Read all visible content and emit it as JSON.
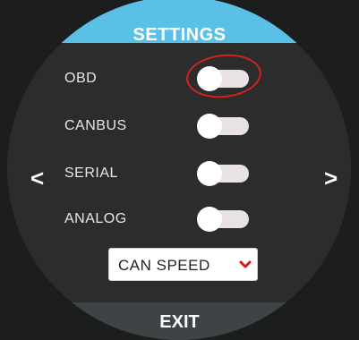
{
  "header": {
    "title": "SETTINGS"
  },
  "settings": [
    {
      "label": "OBD",
      "enabled": false
    },
    {
      "label": "CANBUS",
      "enabled": false
    },
    {
      "label": "SERIAL",
      "enabled": false
    },
    {
      "label": "ANALOG",
      "enabled": false
    }
  ],
  "nav": {
    "prev": "<",
    "next": ">"
  },
  "can_speed": {
    "label": "CAN SPEED"
  },
  "footer": {
    "exit_label": "EXIT"
  },
  "colors": {
    "accent": "#5bc0e5",
    "background": "#2c2c2c",
    "footer": "#3e4446",
    "highlight": "#d91f1f",
    "chevron": "#d11a1a"
  },
  "icons": {
    "dropdown": "chevron-down-icon"
  }
}
